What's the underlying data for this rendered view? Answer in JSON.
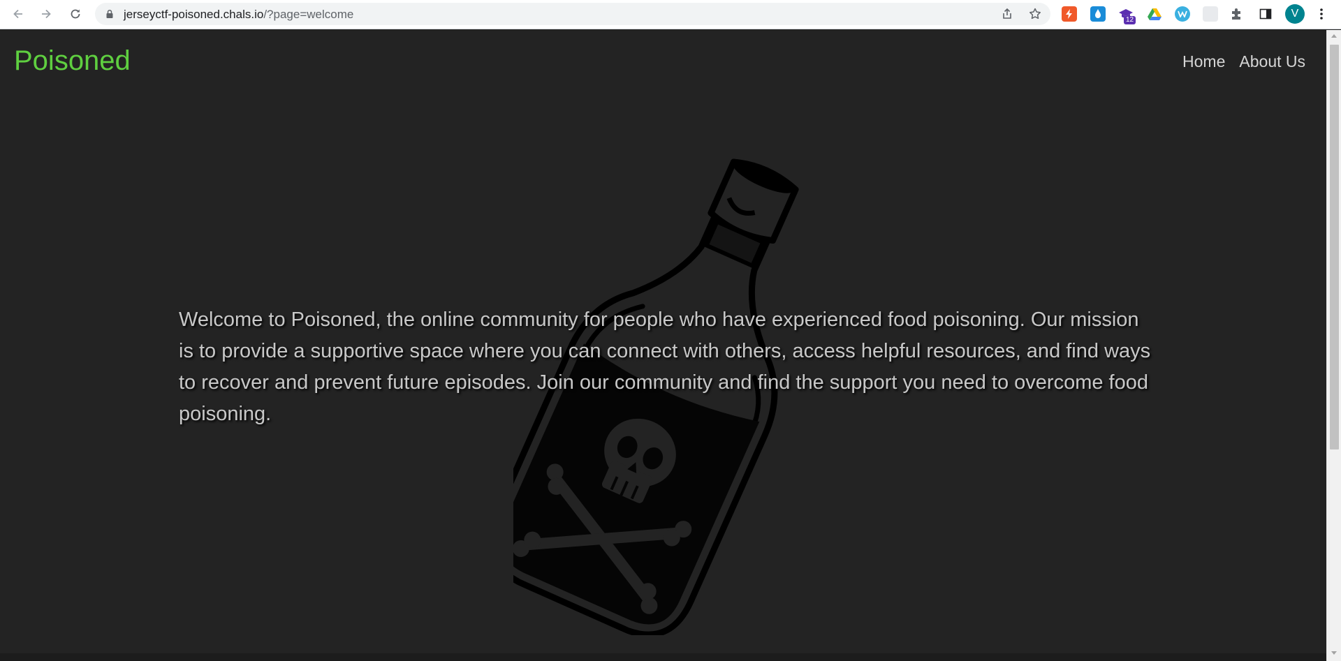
{
  "browser": {
    "url_host": "jerseyctf-poisoned.chals.io",
    "url_path": "/?page=welcome",
    "profile_initial": "V",
    "extension_badge": "12"
  },
  "site": {
    "brand": "Poisoned",
    "nav": [
      {
        "label": "Home"
      },
      {
        "label": "About Us"
      }
    ],
    "welcome_text": "Welcome to Poisoned, the online community for people who have experienced food poisoning. Our mission is to provide a supportive space where you can connect with others, access helpful resources, and find ways to recover and prevent future episodes. Join our community and find the support you need to overcome food poisoning."
  },
  "colors": {
    "page_bg": "#232323",
    "brand": "#5fcf40",
    "nav_text": "#d5d5d5",
    "body_text": "#c8c8c8"
  },
  "icons": {
    "back": "back-arrow-icon",
    "forward": "forward-arrow-icon",
    "reload": "reload-icon",
    "lock": "lock-icon",
    "share": "share-icon",
    "bookmark": "star-icon",
    "extensions": "puzzle-icon",
    "side_panel": "side-panel-icon",
    "menu": "kebab-menu-icon",
    "hero": "poison-bottle-icon"
  }
}
